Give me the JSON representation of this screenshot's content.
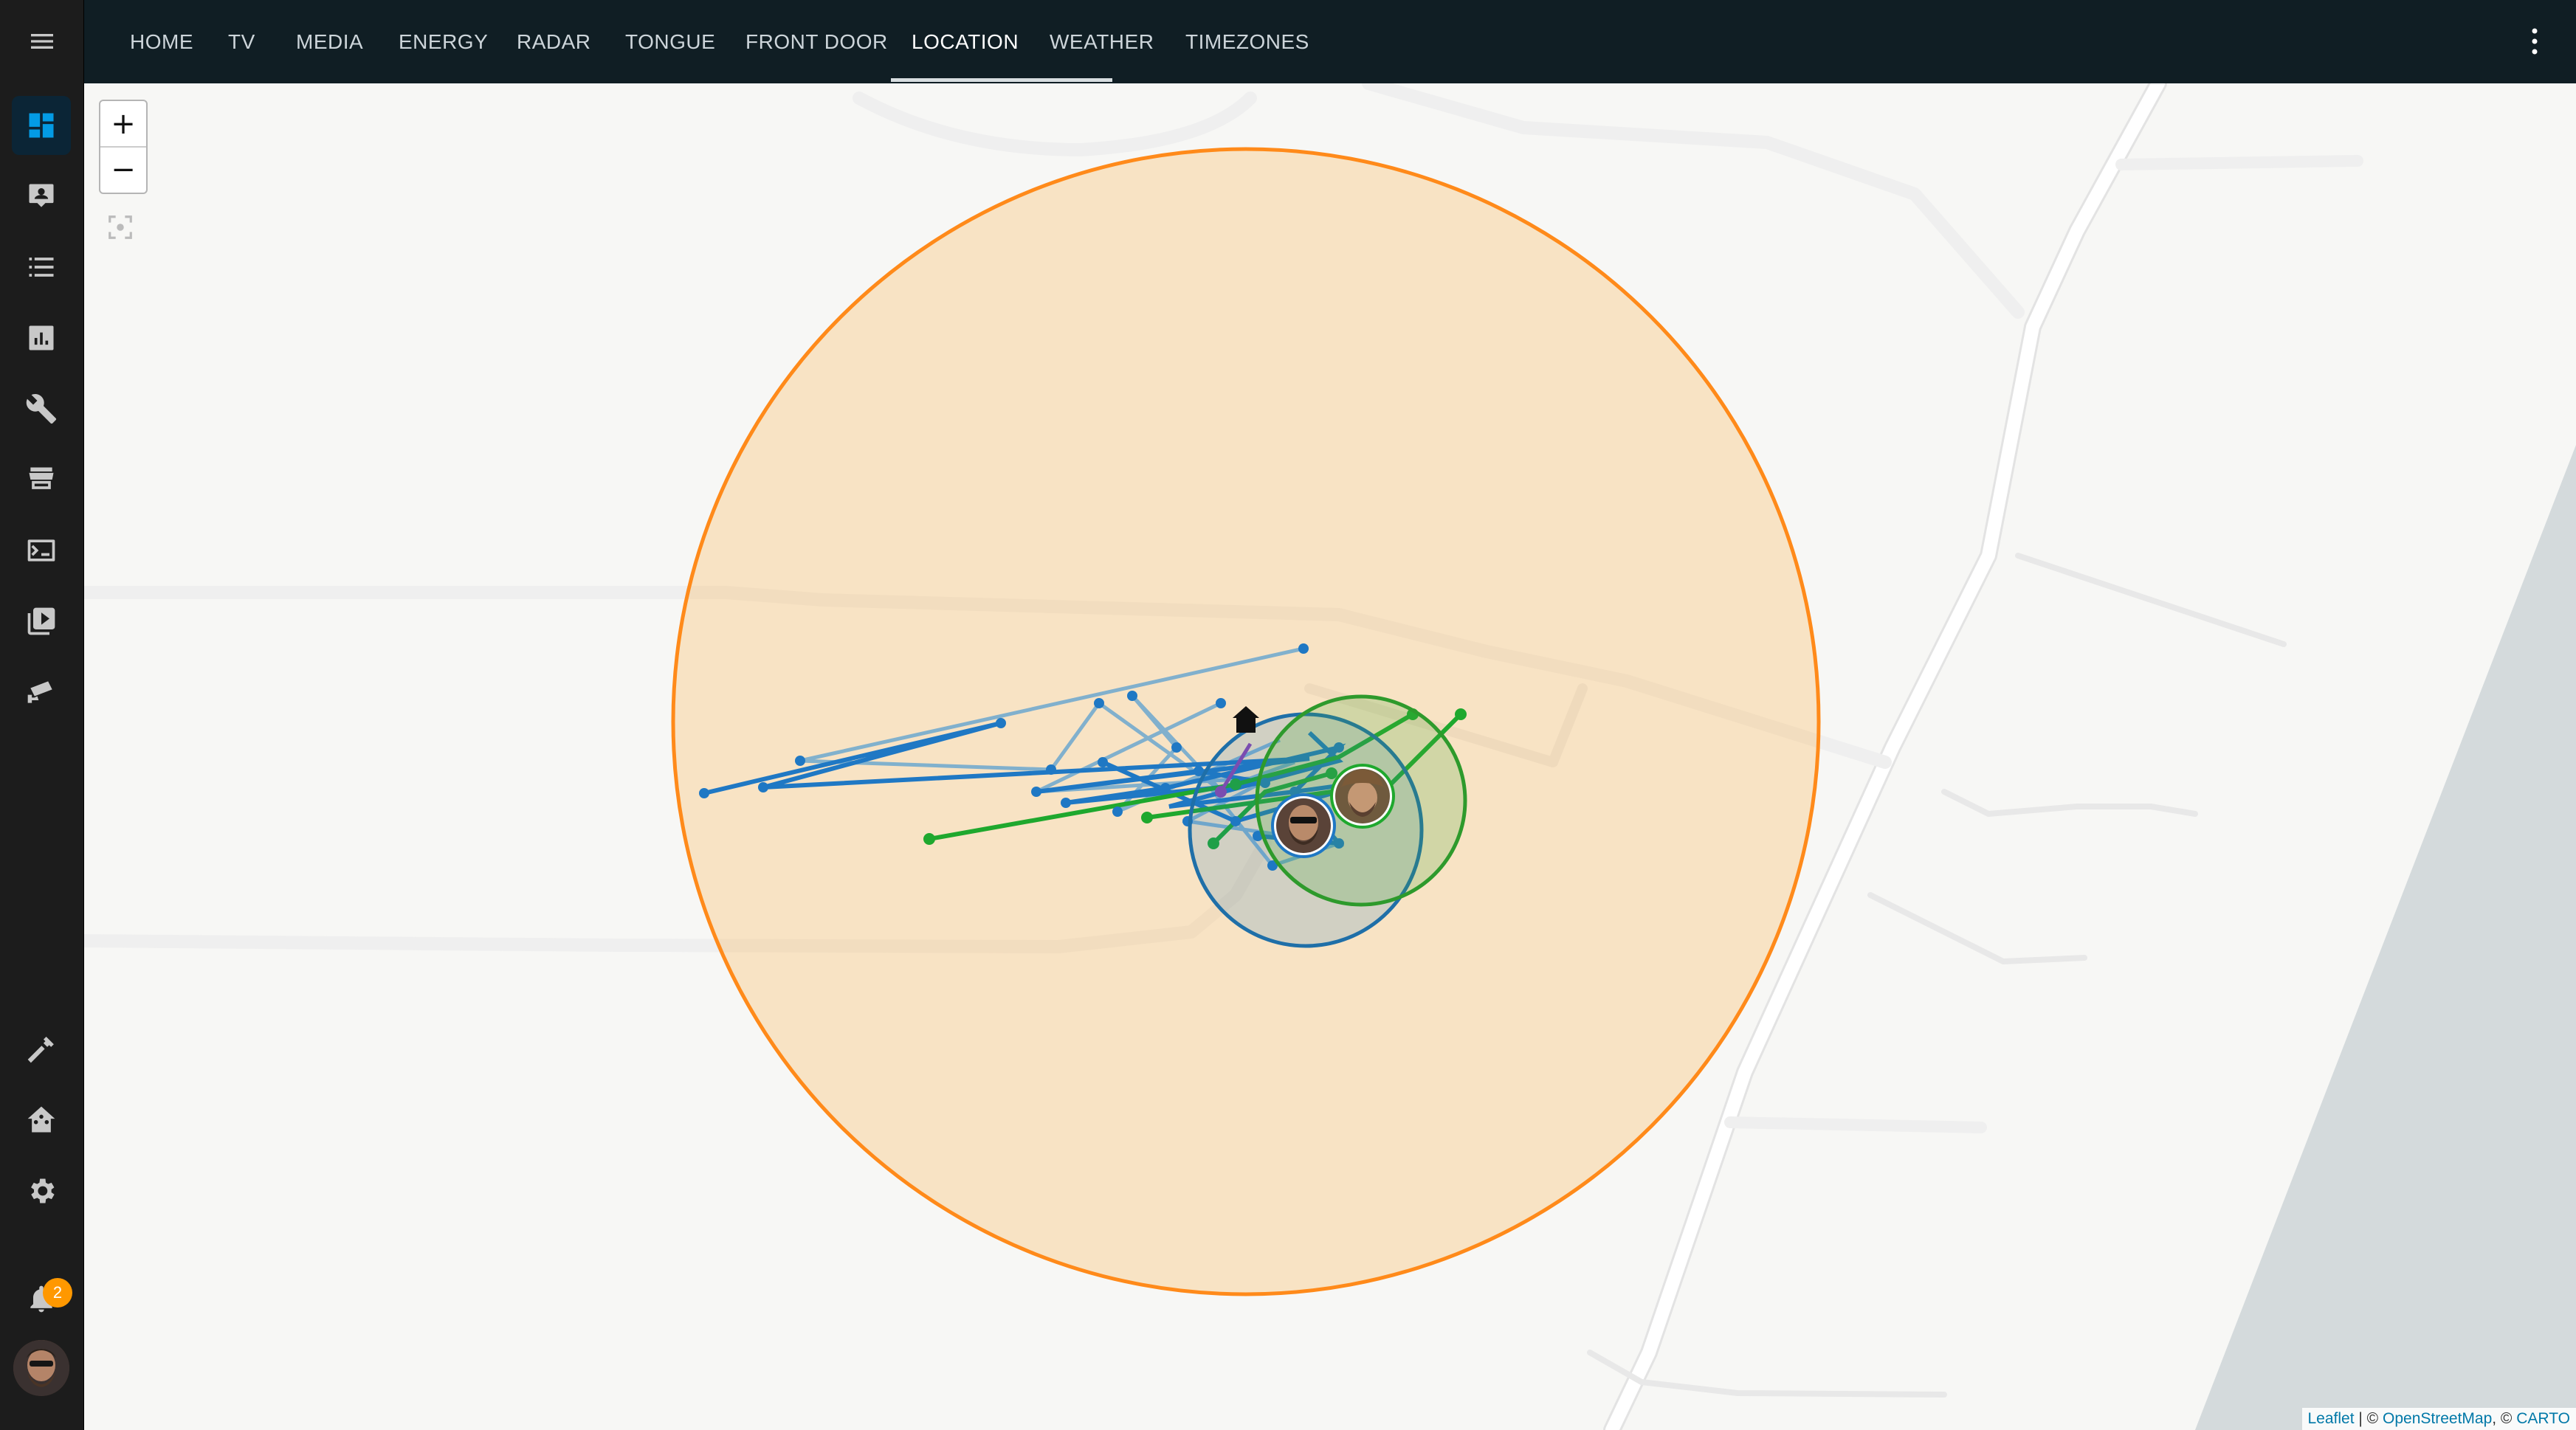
{
  "tabs": [
    {
      "label": "HOME"
    },
    {
      "label": "TV"
    },
    {
      "label": "MEDIA"
    },
    {
      "label": "ENERGY"
    },
    {
      "label": "RADAR"
    },
    {
      "label": "TONGUE"
    },
    {
      "label": "FRONT DOOR"
    },
    {
      "label": "LOCATION",
      "active": true
    },
    {
      "label": "WEATHER"
    },
    {
      "label": "TIMEZONES"
    }
  ],
  "sidebar": {
    "items": [
      {
        "icon": "dashboard-icon",
        "active": true
      },
      {
        "icon": "map-account-icon"
      },
      {
        "icon": "logbook-list-icon"
      },
      {
        "icon": "history-chart-icon"
      },
      {
        "icon": "wrench-icon"
      },
      {
        "icon": "hacs-store-icon"
      },
      {
        "icon": "terminal-icon"
      },
      {
        "icon": "media-play-icon"
      },
      {
        "icon": "cctv-camera-icon"
      },
      {
        "icon": "hammer-icon"
      },
      {
        "icon": "home-assistant-icon"
      },
      {
        "icon": "gear-icon"
      }
    ],
    "notifications_count": "2"
  },
  "map": {
    "zoom_in_label": "+",
    "zoom_out_label": "−",
    "attribution": {
      "leaflet": "Leaflet",
      "sep1": " | © ",
      "osm": "OpenStreetMap",
      "sep2": ", © ",
      "carto": "CARTO"
    }
  },
  "colors": {
    "home_zone": "#ff9800",
    "person_blue": "#1f78c4",
    "person_green": "#1fa82e",
    "active_tab": "#ffffff",
    "sidebar_active": "#039be5"
  }
}
